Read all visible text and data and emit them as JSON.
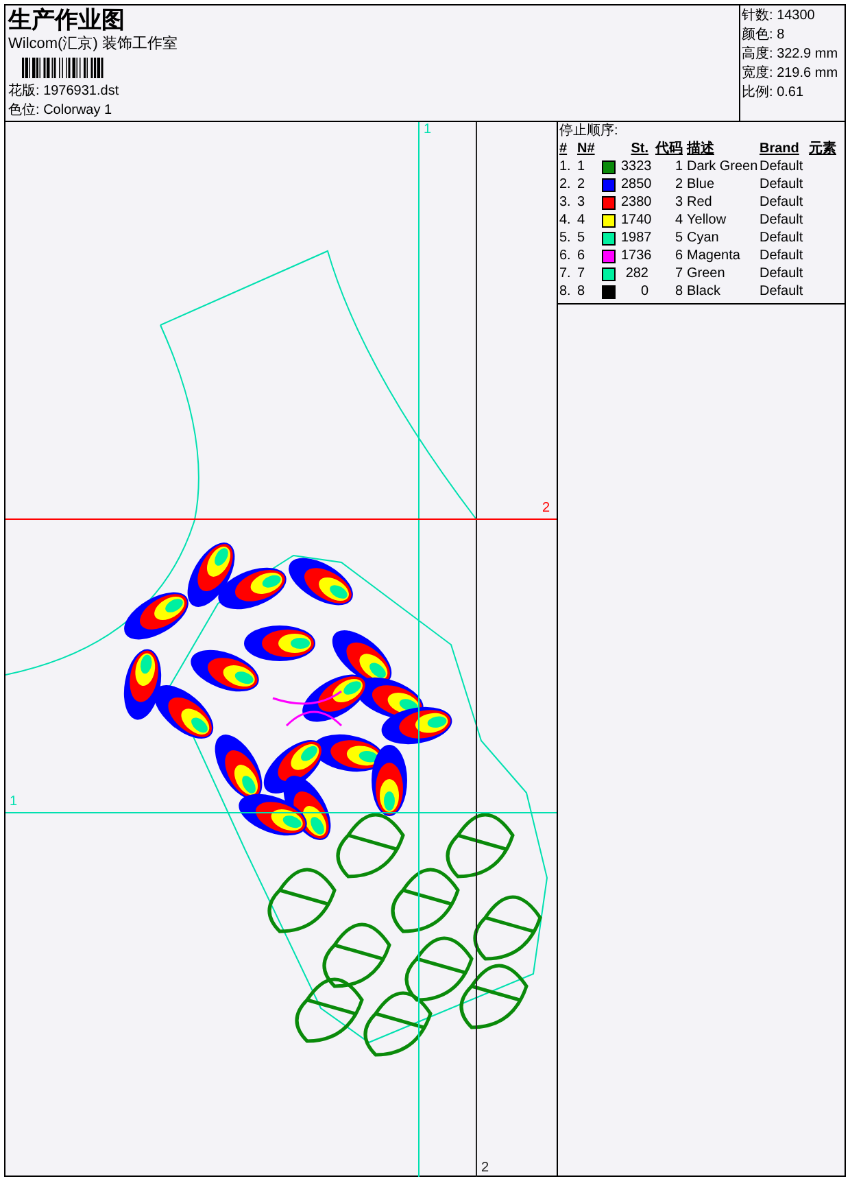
{
  "header": {
    "title": "生产作业图",
    "company": "Wilcom(汇京) 装饰工作室",
    "design_fields": [
      {
        "label": "花版:",
        "value": "1976931.dst"
      },
      {
        "label": "色位:",
        "value": "Colorway 1"
      }
    ]
  },
  "summary": [
    {
      "label": "针数:",
      "value": "14300"
    },
    {
      "label": "颜色:",
      "value": "8"
    },
    {
      "label": "高度:",
      "value": "322.9 mm"
    },
    {
      "label": "宽度:",
      "value": "219.6 mm"
    },
    {
      "label": "比例:",
      "value": "0.61"
    }
  ],
  "canvas": {
    "guides": [
      {
        "kind": "vertical",
        "label": "1",
        "color": "#00e0b0"
      },
      {
        "kind": "vertical",
        "label": "2",
        "color": "#202020"
      },
      {
        "kind": "horizontal",
        "label": "2",
        "color": "#ff0000"
      },
      {
        "kind": "horizontal",
        "label": "1",
        "color": "#00e0b0"
      }
    ]
  },
  "stop_sequence": {
    "title": "停止顺序:",
    "columns": [
      "#",
      "N#",
      "St.",
      "代码",
      "描述",
      "Brand",
      "元素"
    ],
    "rows": [
      {
        "index": "1.",
        "needle": "1",
        "color": "#0a8a0a",
        "stitches": "3323",
        "code": "1",
        "description": "Dark Green",
        "brand": "Default"
      },
      {
        "index": "2.",
        "needle": "2",
        "color": "#0000ff",
        "stitches": "2850",
        "code": "2",
        "description": "Blue",
        "brand": "Default"
      },
      {
        "index": "3.",
        "needle": "3",
        "color": "#ff0000",
        "stitches": "2380",
        "code": "3",
        "description": "Red",
        "brand": "Default"
      },
      {
        "index": "4.",
        "needle": "4",
        "color": "#ffff00",
        "stitches": "1740",
        "code": "4",
        "description": "Yellow",
        "brand": "Default"
      },
      {
        "index": "5.",
        "needle": "5",
        "color": "#00f0a0",
        "stitches": "1987",
        "code": "5",
        "description": "Cyan",
        "brand": "Default"
      },
      {
        "index": "6.",
        "needle": "6",
        "color": "#ff00ff",
        "stitches": "1736",
        "code": "6",
        "description": "Magenta",
        "brand": "Default"
      },
      {
        "index": "7.",
        "needle": "7",
        "color": "#00f0a0",
        "stitches": "282",
        "code": "7",
        "description": "Green",
        "brand": "Default"
      },
      {
        "index": "8.",
        "needle": "8",
        "color": "#000000",
        "stitches": "0",
        "code": "8",
        "description": "Black",
        "brand": "Default"
      }
    ]
  }
}
